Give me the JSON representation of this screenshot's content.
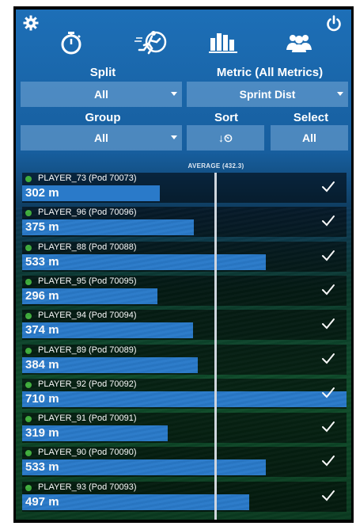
{
  "header": {
    "icons": [
      "gear-icon",
      "stopwatch-icon",
      "runner-icon",
      "bar-chart-icon",
      "team-icon",
      "power-icon"
    ]
  },
  "filters": {
    "split_label": "Split",
    "split_value": "All",
    "metric_label": "Metric (All Metrics)",
    "metric_value": "Sprint Dist",
    "group_label": "Group",
    "group_value": "All",
    "sort_label": "Sort",
    "sort_value": "↓⏲",
    "select_label": "Select",
    "select_value": "All"
  },
  "average": {
    "label": "AVERAGE (432.3)",
    "value": 432.3
  },
  "scale_max": 710,
  "colors": {
    "bar": "#2a7ac9",
    "status_dot": "#3fae3c",
    "control_bg": "#78aad7"
  },
  "players": [
    {
      "name": "PLAYER_73 (Pod 70073)",
      "value": 302,
      "label": "302 m",
      "selected": true
    },
    {
      "name": "PLAYER_96 (Pod 70096)",
      "value": 375,
      "label": "375 m",
      "selected": true
    },
    {
      "name": "PLAYER_88 (Pod 70088)",
      "value": 533,
      "label": "533 m",
      "selected": true
    },
    {
      "name": "PLAYER_95 (Pod 70095)",
      "value": 296,
      "label": "296 m",
      "selected": true
    },
    {
      "name": "PLAYER_94 (Pod 70094)",
      "value": 374,
      "label": "374 m",
      "selected": true
    },
    {
      "name": "PLAYER_89 (Pod 70089)",
      "value": 384,
      "label": "384 m",
      "selected": true
    },
    {
      "name": "PLAYER_92 (Pod 70092)",
      "value": 710,
      "label": "710 m",
      "selected": true
    },
    {
      "name": "PLAYER_91 (Pod 70091)",
      "value": 319,
      "label": "319 m",
      "selected": true
    },
    {
      "name": "PLAYER_90 (Pod 70090)",
      "value": 533,
      "label": "533 m",
      "selected": true
    },
    {
      "name": "PLAYER_93 (Pod 70093)",
      "value": 497,
      "label": "497 m",
      "selected": true
    }
  ]
}
